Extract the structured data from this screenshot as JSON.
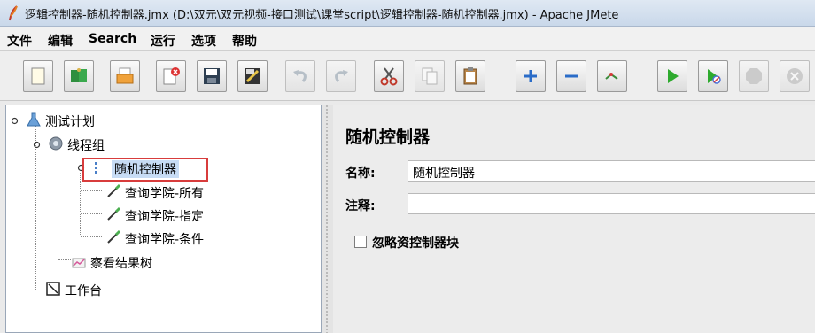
{
  "window": {
    "title": "逻辑控制器-随机控制器.jmx (D:\\双元\\双元视频-接口测试\\课堂script\\逻辑控制器-随机控制器.jmx) - Apache JMete"
  },
  "menu": {
    "items": [
      {
        "label": "文件"
      },
      {
        "label": "编辑"
      },
      {
        "label": "Search"
      },
      {
        "label": "运行"
      },
      {
        "label": "选项"
      },
      {
        "label": "帮助"
      }
    ]
  },
  "toolbar": {
    "buttons": [
      {
        "name": "new",
        "icon": "new-file-icon"
      },
      {
        "name": "templates",
        "icon": "templates-icon"
      },
      {
        "name": "open",
        "icon": "open-folder-icon"
      },
      {
        "name": "close",
        "icon": "close-file-icon"
      },
      {
        "name": "save",
        "icon": "save-icon"
      },
      {
        "name": "save-as",
        "icon": "save-as-icon"
      },
      {
        "name": "undo",
        "icon": "undo-icon"
      },
      {
        "name": "redo",
        "icon": "redo-icon"
      },
      {
        "name": "cut",
        "icon": "cut-icon"
      },
      {
        "name": "copy",
        "icon": "copy-icon"
      },
      {
        "name": "paste",
        "icon": "paste-icon"
      },
      {
        "name": "expand",
        "icon": "plus-icon"
      },
      {
        "name": "collapse",
        "icon": "minus-icon"
      },
      {
        "name": "toggle",
        "icon": "toggle-icon"
      },
      {
        "name": "start",
        "icon": "play-icon"
      },
      {
        "name": "start-no-pause",
        "icon": "play-no-pause-icon"
      },
      {
        "name": "stop",
        "icon": "stop-icon"
      },
      {
        "name": "shutdown",
        "icon": "shutdown-icon"
      }
    ]
  },
  "tree": {
    "nodes": [
      {
        "label": "测试计划",
        "icon": "test-plan-icon"
      },
      {
        "label": "线程组",
        "icon": "thread-group-icon"
      },
      {
        "label": "随机控制器",
        "icon": "random-controller-icon"
      },
      {
        "label": "查询学院-所有",
        "icon": "sampler-icon"
      },
      {
        "label": "查询学院-指定",
        "icon": "sampler-icon"
      },
      {
        "label": "查询学院-条件",
        "icon": "sampler-icon"
      },
      {
        "label": "察看结果树",
        "icon": "results-tree-icon"
      },
      {
        "label": "工作台",
        "icon": "workbench-icon"
      }
    ]
  },
  "panel": {
    "title": "随机控制器",
    "name_label": "名称:",
    "name_value": "随机控制器",
    "comment_label": "注释:",
    "comment_value": "",
    "checkbox_label": "忽略资控制器块",
    "checkbox_checked": false
  }
}
